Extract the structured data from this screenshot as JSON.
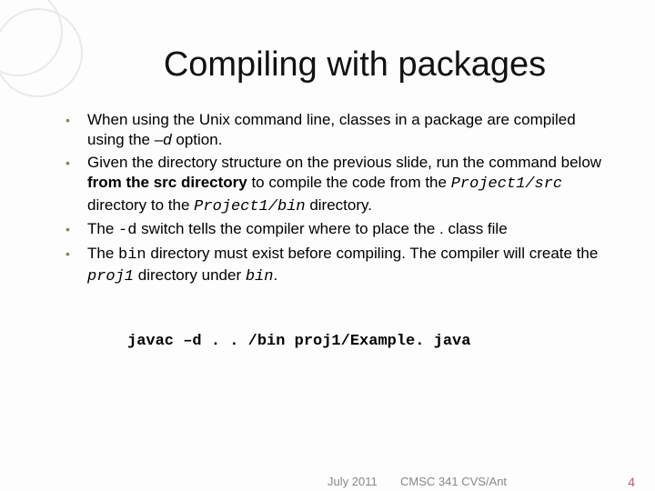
{
  "title": "Compiling with packages",
  "bullets": {
    "b1": {
      "t1": "When using the Unix command line, classes in a package are compiled using the ",
      "opt": "–d",
      "t2": " option."
    },
    "b2": {
      "t1": "Given the directory structure on the previous slide, run the command below ",
      "bold": "from the src directory",
      "t2": " to compile the code from the ",
      "m1": "Project1/src",
      "t3": " directory to the ",
      "m2": "Project1/bin",
      "t4": " directory."
    },
    "b3": {
      "t1": "The ",
      "m1": "-d",
      "t2": " switch tells the compiler where to place the . class file"
    },
    "b4": {
      "t1": "The ",
      "m1": "bin",
      "t2": " directory must exist before compiling. The compiler will create the ",
      "m2": "proj1",
      "t3": " directory under ",
      "m3": "bin",
      "t4": "."
    }
  },
  "command": "javac –d . . /bin proj1/Example. java",
  "footer": {
    "date": "July 2011",
    "course": "CMSC 341 CVS/Ant",
    "page": "4"
  }
}
